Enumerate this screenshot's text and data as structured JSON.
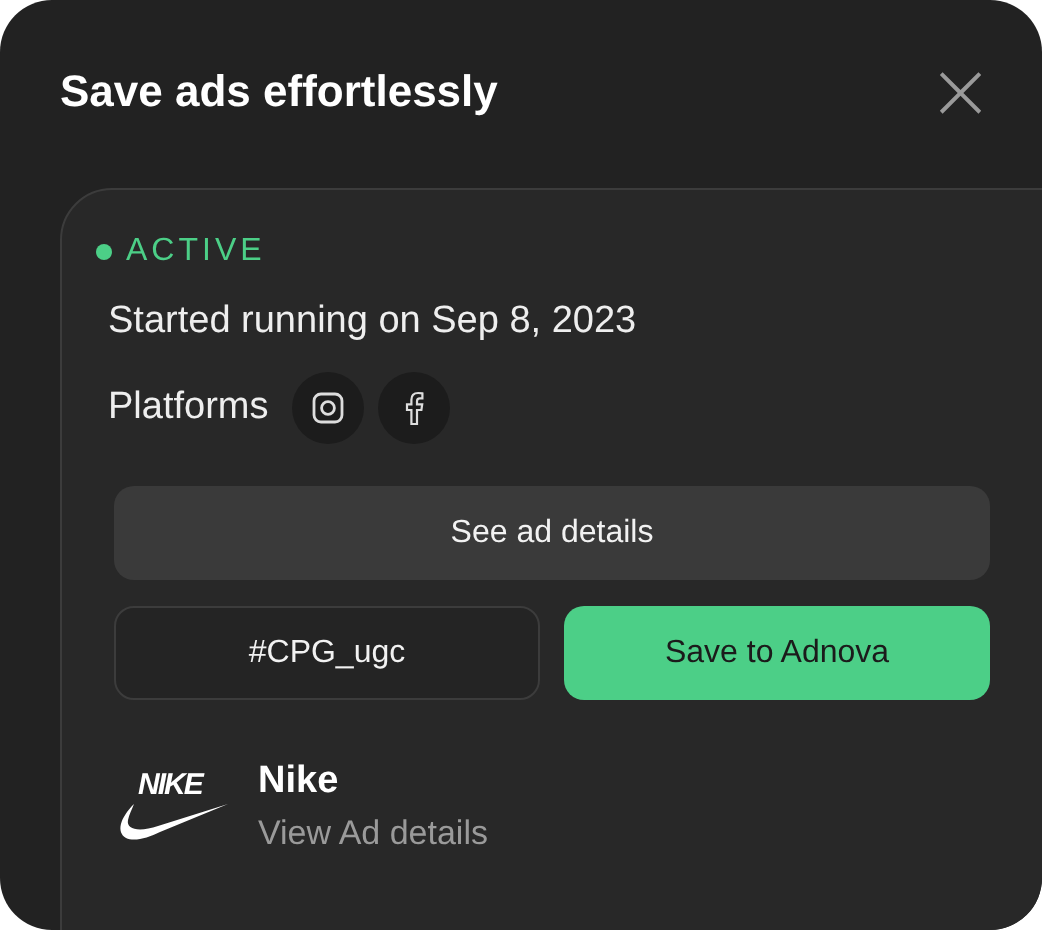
{
  "dialog": {
    "title": "Save ads effortlessly",
    "close": "×"
  },
  "ad": {
    "status": {
      "label": "ACTIVE",
      "kind": "active"
    },
    "started": "Started running on Sep 8, 2023",
    "platforms_label": "Platforms",
    "platforms": [
      {
        "kind": "instagram"
      },
      {
        "kind": "facebook"
      }
    ],
    "details_button": "See ad details",
    "collection": "#CPG_ugc",
    "save_button": "Save to Adnova",
    "advertiser": {
      "logo_text": "NIKE",
      "name": "Nike",
      "link": "View Ad details"
    }
  }
}
